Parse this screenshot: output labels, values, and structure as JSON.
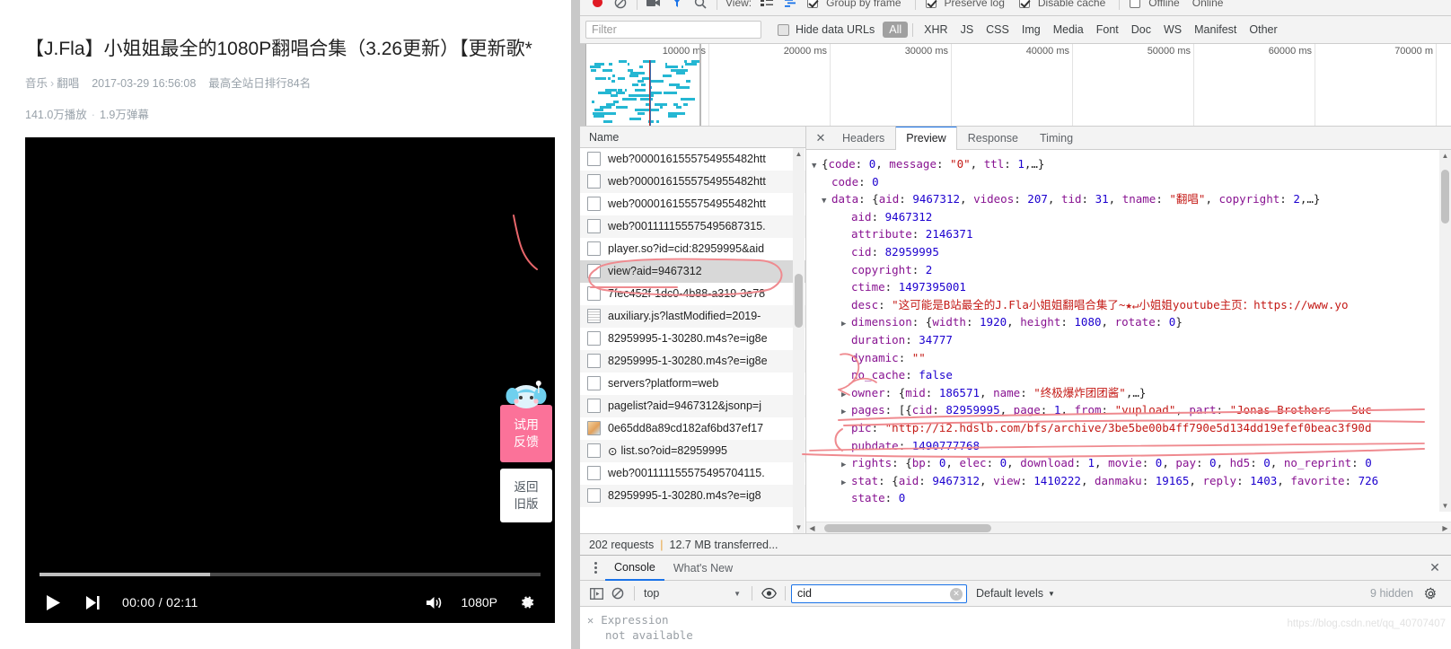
{
  "video": {
    "title": "【J.Fla】小姐姐最全的1080P翻唱合集（3.26更新）【更新歌*",
    "category_main": "音乐",
    "category_sep": "›",
    "category_sub": "翻唱",
    "publish_date": "2017-03-29 16:56:08",
    "rank_text": "最高全站日排行84名",
    "play_count": "141.0万播放",
    "danmaku_count": "1.9万弹幕",
    "count_dot": "·",
    "player": {
      "play_icon": "play-icon",
      "next_icon": "next-track-icon",
      "time_current": "00:00",
      "time_sep": "/",
      "time_total": "02:11",
      "time_display": "00:00 / 02:11",
      "volume_icon": "volume-icon",
      "quality": "1080P",
      "settings_icon": "gear-icon",
      "progress_percent": 34
    },
    "side_buttons": {
      "feedback_line1": "试用",
      "feedback_line2": "反馈",
      "feedback_color": "#fb7299",
      "old_version_line1": "返回",
      "old_version_line2": "旧版"
    }
  },
  "devtools": {
    "network": {
      "toolbar": {
        "record_icon": "record-stop-icon",
        "clear_icon": "clear-icon",
        "camera_icon": "camera-icon",
        "filter_icon": "funnel-icon",
        "search_icon": "search-icon",
        "view_label": "View:",
        "list_view_icon": "list-view-icon",
        "waterfall_view_icon": "waterfall-view-icon",
        "group_by_frame": "Group by frame",
        "preserve_log": "Preserve log",
        "disable_cache": "Disable cache",
        "offline": "Offline",
        "online": "Online"
      },
      "filter_placeholder": "Filter",
      "hide_data_urls": "Hide data URLs",
      "type_filters": [
        "All",
        "XHR",
        "JS",
        "CSS",
        "Img",
        "Media",
        "Font",
        "Doc",
        "WS",
        "Manifest",
        "Other"
      ],
      "active_type_filter": "All",
      "timeline_ticks": [
        "10000 ms",
        "20000 ms",
        "30000 ms",
        "40000 ms",
        "50000 ms",
        "60000 ms",
        "70000 m"
      ],
      "list_header": "Name",
      "requests": [
        {
          "name": "web?0000161555754955482htt",
          "icon": "generic-file-icon",
          "selected": false
        },
        {
          "name": "web?0000161555754955482htt",
          "icon": "generic-file-icon",
          "selected": false
        },
        {
          "name": "web?0000161555754955482htt",
          "icon": "generic-file-icon",
          "selected": false
        },
        {
          "name": "web?001111155575495687315.",
          "icon": "generic-file-icon",
          "selected": false
        },
        {
          "name": "player.so?id=cid:82959995&aid",
          "icon": "generic-file-icon",
          "selected": false
        },
        {
          "name": "view?aid=9467312",
          "icon": "generic-file-icon",
          "selected": true
        },
        {
          "name": "7fec452f-1dc0-4b88-a319-3e78",
          "icon": "generic-file-icon",
          "selected": false
        },
        {
          "name": "auxiliary.js?lastModified=2019-",
          "icon": "script-file-icon",
          "selected": false
        },
        {
          "name": "82959995-1-30280.m4s?e=ig8e",
          "icon": "generic-file-icon",
          "selected": false
        },
        {
          "name": "82959995-1-30280.m4s?e=ig8e",
          "icon": "generic-file-icon",
          "selected": false
        },
        {
          "name": "servers?platform=web",
          "icon": "generic-file-icon",
          "selected": false
        },
        {
          "name": "pagelist?aid=9467312&jsonp=j",
          "icon": "generic-file-icon",
          "selected": false
        },
        {
          "name": "0e65dd8a89cd182af6bd37ef17",
          "icon": "image-file-icon",
          "selected": false
        },
        {
          "name": "list.so?oid=82959995",
          "icon": "generic-file-icon",
          "selected": false,
          "pending": true,
          "pending_icon": "clock-icon"
        },
        {
          "name": "web?001111155575495704115.",
          "icon": "generic-file-icon",
          "selected": false
        },
        {
          "name": "82959995-1-30280.m4s?e=ig8",
          "icon": "generic-file-icon",
          "selected": false
        }
      ],
      "status_requests": "202 requests",
      "status_sep": "|",
      "status_transferred": "12.7 MB transferred...",
      "detail_tabs": [
        "Headers",
        "Preview",
        "Response",
        "Timing"
      ],
      "active_detail_tab": "Preview",
      "close_icon": "close-icon"
    },
    "preview_json": [
      {
        "indent": 0,
        "arrow": "open",
        "parts": [
          {
            "t": "pun",
            "v": "{"
          },
          {
            "t": "k",
            "v": "code"
          },
          {
            "t": "pun",
            "v": ": "
          },
          {
            "t": "num",
            "v": "0"
          },
          {
            "t": "pun",
            "v": ", "
          },
          {
            "t": "k",
            "v": "message"
          },
          {
            "t": "pun",
            "v": ": "
          },
          {
            "t": "str",
            "v": "\"0\""
          },
          {
            "t": "pun",
            "v": ", "
          },
          {
            "t": "k",
            "v": "ttl"
          },
          {
            "t": "pun",
            "v": ": "
          },
          {
            "t": "num",
            "v": "1"
          },
          {
            "t": "pun",
            "v": ",…}"
          }
        ]
      },
      {
        "indent": 1,
        "arrow": "none",
        "parts": [
          {
            "t": "k",
            "v": "code"
          },
          {
            "t": "pun",
            "v": ": "
          },
          {
            "t": "num",
            "v": "0"
          }
        ]
      },
      {
        "indent": 1,
        "arrow": "open",
        "parts": [
          {
            "t": "k",
            "v": "data"
          },
          {
            "t": "pun",
            "v": ": {"
          },
          {
            "t": "k",
            "v": "aid"
          },
          {
            "t": "pun",
            "v": ": "
          },
          {
            "t": "num",
            "v": "9467312"
          },
          {
            "t": "pun",
            "v": ", "
          },
          {
            "t": "k",
            "v": "videos"
          },
          {
            "t": "pun",
            "v": ": "
          },
          {
            "t": "num",
            "v": "207"
          },
          {
            "t": "pun",
            "v": ", "
          },
          {
            "t": "k",
            "v": "tid"
          },
          {
            "t": "pun",
            "v": ": "
          },
          {
            "t": "num",
            "v": "31"
          },
          {
            "t": "pun",
            "v": ", "
          },
          {
            "t": "k",
            "v": "tname"
          },
          {
            "t": "pun",
            "v": ": "
          },
          {
            "t": "str",
            "v": "\"翻唱\""
          },
          {
            "t": "pun",
            "v": ", "
          },
          {
            "t": "k",
            "v": "copyright"
          },
          {
            "t": "pun",
            "v": ": "
          },
          {
            "t": "num",
            "v": "2"
          },
          {
            "t": "pun",
            "v": ",…}"
          }
        ]
      },
      {
        "indent": 2,
        "arrow": "none",
        "parts": [
          {
            "t": "k",
            "v": "aid"
          },
          {
            "t": "pun",
            "v": ": "
          },
          {
            "t": "num",
            "v": "9467312"
          }
        ]
      },
      {
        "indent": 2,
        "arrow": "none",
        "parts": [
          {
            "t": "k",
            "v": "attribute"
          },
          {
            "t": "pun",
            "v": ": "
          },
          {
            "t": "num",
            "v": "2146371"
          }
        ]
      },
      {
        "indent": 2,
        "arrow": "none",
        "parts": [
          {
            "t": "k",
            "v": "cid"
          },
          {
            "t": "pun",
            "v": ": "
          },
          {
            "t": "num",
            "v": "82959995"
          }
        ]
      },
      {
        "indent": 2,
        "arrow": "none",
        "parts": [
          {
            "t": "k",
            "v": "copyright"
          },
          {
            "t": "pun",
            "v": ": "
          },
          {
            "t": "num",
            "v": "2"
          }
        ]
      },
      {
        "indent": 2,
        "arrow": "none",
        "parts": [
          {
            "t": "k",
            "v": "ctime"
          },
          {
            "t": "pun",
            "v": ": "
          },
          {
            "t": "num",
            "v": "1497395001"
          }
        ]
      },
      {
        "indent": 2,
        "arrow": "none",
        "parts": [
          {
            "t": "k",
            "v": "desc"
          },
          {
            "t": "pun",
            "v": ": "
          },
          {
            "t": "str",
            "v": "\"这可能是B站最全的J.Fla小姐姐翻唱合集了~★↵小姐姐youtube主页：https://www.yo"
          }
        ]
      },
      {
        "indent": 2,
        "arrow": "closed",
        "parts": [
          {
            "t": "k",
            "v": "dimension"
          },
          {
            "t": "pun",
            "v": ": {"
          },
          {
            "t": "k",
            "v": "width"
          },
          {
            "t": "pun",
            "v": ": "
          },
          {
            "t": "num",
            "v": "1920"
          },
          {
            "t": "pun",
            "v": ", "
          },
          {
            "t": "k",
            "v": "height"
          },
          {
            "t": "pun",
            "v": ": "
          },
          {
            "t": "num",
            "v": "1080"
          },
          {
            "t": "pun",
            "v": ", "
          },
          {
            "t": "k",
            "v": "rotate"
          },
          {
            "t": "pun",
            "v": ": "
          },
          {
            "t": "num",
            "v": "0"
          },
          {
            "t": "pun",
            "v": "}"
          }
        ]
      },
      {
        "indent": 2,
        "arrow": "none",
        "parts": [
          {
            "t": "k",
            "v": "duration"
          },
          {
            "t": "pun",
            "v": ": "
          },
          {
            "t": "num",
            "v": "34777"
          }
        ]
      },
      {
        "indent": 2,
        "arrow": "none",
        "parts": [
          {
            "t": "k",
            "v": "dynamic"
          },
          {
            "t": "pun",
            "v": ": "
          },
          {
            "t": "str",
            "v": "\"\""
          }
        ]
      },
      {
        "indent": 2,
        "arrow": "none",
        "parts": [
          {
            "t": "k",
            "v": "no_cache"
          },
          {
            "t": "pun",
            "v": ": "
          },
          {
            "t": "bool",
            "v": "false"
          }
        ]
      },
      {
        "indent": 2,
        "arrow": "closed",
        "parts": [
          {
            "t": "k",
            "v": "owner"
          },
          {
            "t": "pun",
            "v": ": {"
          },
          {
            "t": "k",
            "v": "mid"
          },
          {
            "t": "pun",
            "v": ": "
          },
          {
            "t": "num",
            "v": "186571"
          },
          {
            "t": "pun",
            "v": ", "
          },
          {
            "t": "k",
            "v": "name"
          },
          {
            "t": "pun",
            "v": ": "
          },
          {
            "t": "str",
            "v": "\"终极爆炸团团酱\""
          },
          {
            "t": "pun",
            "v": ",…}"
          }
        ]
      },
      {
        "indent": 2,
        "arrow": "closed",
        "parts": [
          {
            "t": "k",
            "v": "pages"
          },
          {
            "t": "pun",
            "v": ": [{"
          },
          {
            "t": "k",
            "v": "cid"
          },
          {
            "t": "pun",
            "v": ": "
          },
          {
            "t": "num",
            "v": "82959995"
          },
          {
            "t": "pun",
            "v": ", "
          },
          {
            "t": "k",
            "v": "page"
          },
          {
            "t": "pun",
            "v": ": "
          },
          {
            "t": "num",
            "v": "1"
          },
          {
            "t": "pun",
            "v": ", "
          },
          {
            "t": "k",
            "v": "from"
          },
          {
            "t": "pun",
            "v": ": "
          },
          {
            "t": "str",
            "v": "\"vupload\""
          },
          {
            "t": "pun",
            "v": ", "
          },
          {
            "t": "k",
            "v": "part"
          },
          {
            "t": "pun",
            "v": ": "
          },
          {
            "t": "str",
            "v": "\"Jonas Brothers - Suc"
          }
        ]
      },
      {
        "indent": 2,
        "arrow": "none",
        "parts": [
          {
            "t": "k",
            "v": "pic"
          },
          {
            "t": "pun",
            "v": ": "
          },
          {
            "t": "str",
            "v": "\"http://i2.hdslb.com/bfs/archive/3be5be00b4ff790e5d134dd19efef0beac3f90d"
          }
        ]
      },
      {
        "indent": 2,
        "arrow": "none",
        "parts": [
          {
            "t": "k",
            "v": "pubdate"
          },
          {
            "t": "pun",
            "v": ": "
          },
          {
            "t": "num",
            "v": "1490777768"
          }
        ]
      },
      {
        "indent": 2,
        "arrow": "closed",
        "parts": [
          {
            "t": "k",
            "v": "rights"
          },
          {
            "t": "pun",
            "v": ": {"
          },
          {
            "t": "k",
            "v": "bp"
          },
          {
            "t": "pun",
            "v": ": "
          },
          {
            "t": "num",
            "v": "0"
          },
          {
            "t": "pun",
            "v": ", "
          },
          {
            "t": "k",
            "v": "elec"
          },
          {
            "t": "pun",
            "v": ": "
          },
          {
            "t": "num",
            "v": "0"
          },
          {
            "t": "pun",
            "v": ", "
          },
          {
            "t": "k",
            "v": "download"
          },
          {
            "t": "pun",
            "v": ": "
          },
          {
            "t": "num",
            "v": "1"
          },
          {
            "t": "pun",
            "v": ", "
          },
          {
            "t": "k",
            "v": "movie"
          },
          {
            "t": "pun",
            "v": ": "
          },
          {
            "t": "num",
            "v": "0"
          },
          {
            "t": "pun",
            "v": ", "
          },
          {
            "t": "k",
            "v": "pay"
          },
          {
            "t": "pun",
            "v": ": "
          },
          {
            "t": "num",
            "v": "0"
          },
          {
            "t": "pun",
            "v": ", "
          },
          {
            "t": "k",
            "v": "hd5"
          },
          {
            "t": "pun",
            "v": ": "
          },
          {
            "t": "num",
            "v": "0"
          },
          {
            "t": "pun",
            "v": ", "
          },
          {
            "t": "k",
            "v": "no_reprint"
          },
          {
            "t": "pun",
            "v": ": "
          },
          {
            "t": "num",
            "v": "0"
          }
        ]
      },
      {
        "indent": 2,
        "arrow": "closed",
        "parts": [
          {
            "t": "k",
            "v": "stat"
          },
          {
            "t": "pun",
            "v": ": {"
          },
          {
            "t": "k",
            "v": "aid"
          },
          {
            "t": "pun",
            "v": ": "
          },
          {
            "t": "num",
            "v": "9467312"
          },
          {
            "t": "pun",
            "v": ", "
          },
          {
            "t": "k",
            "v": "view"
          },
          {
            "t": "pun",
            "v": ": "
          },
          {
            "t": "num",
            "v": "1410222"
          },
          {
            "t": "pun",
            "v": ", "
          },
          {
            "t": "k",
            "v": "danmaku"
          },
          {
            "t": "pun",
            "v": ": "
          },
          {
            "t": "num",
            "v": "19165"
          },
          {
            "t": "pun",
            "v": ", "
          },
          {
            "t": "k",
            "v": "reply"
          },
          {
            "t": "pun",
            "v": ": "
          },
          {
            "t": "num",
            "v": "1403"
          },
          {
            "t": "pun",
            "v": ", "
          },
          {
            "t": "k",
            "v": "favorite"
          },
          {
            "t": "pun",
            "v": ": "
          },
          {
            "t": "num",
            "v": "726"
          }
        ]
      },
      {
        "indent": 2,
        "arrow": "none",
        "parts": [
          {
            "t": "k",
            "v": "state"
          },
          {
            "t": "pun",
            "v": ": "
          },
          {
            "t": "num",
            "v": "0"
          }
        ]
      }
    ],
    "drawer": {
      "kebab_icon": "more-options-icon",
      "tabs": [
        "Console",
        "What's New"
      ],
      "active_tab": "Console",
      "close_icon": "close-icon",
      "sidebar_icon": "console-sidebar-icon",
      "clear_icon": "clear-console-icon",
      "context": "top",
      "eye_icon": "live-expression-eye-icon",
      "filter_value": "cid",
      "filter_clear_icon": "clear-input-icon",
      "levels": "Default levels",
      "hidden": "9 hidden",
      "settings_icon": "gear-icon",
      "expression_label": "Expression",
      "expression_close_icon": "close-expression-icon",
      "expression_value": "not available"
    }
  },
  "watermark": "https://blog.csdn.net/qq_40707407"
}
